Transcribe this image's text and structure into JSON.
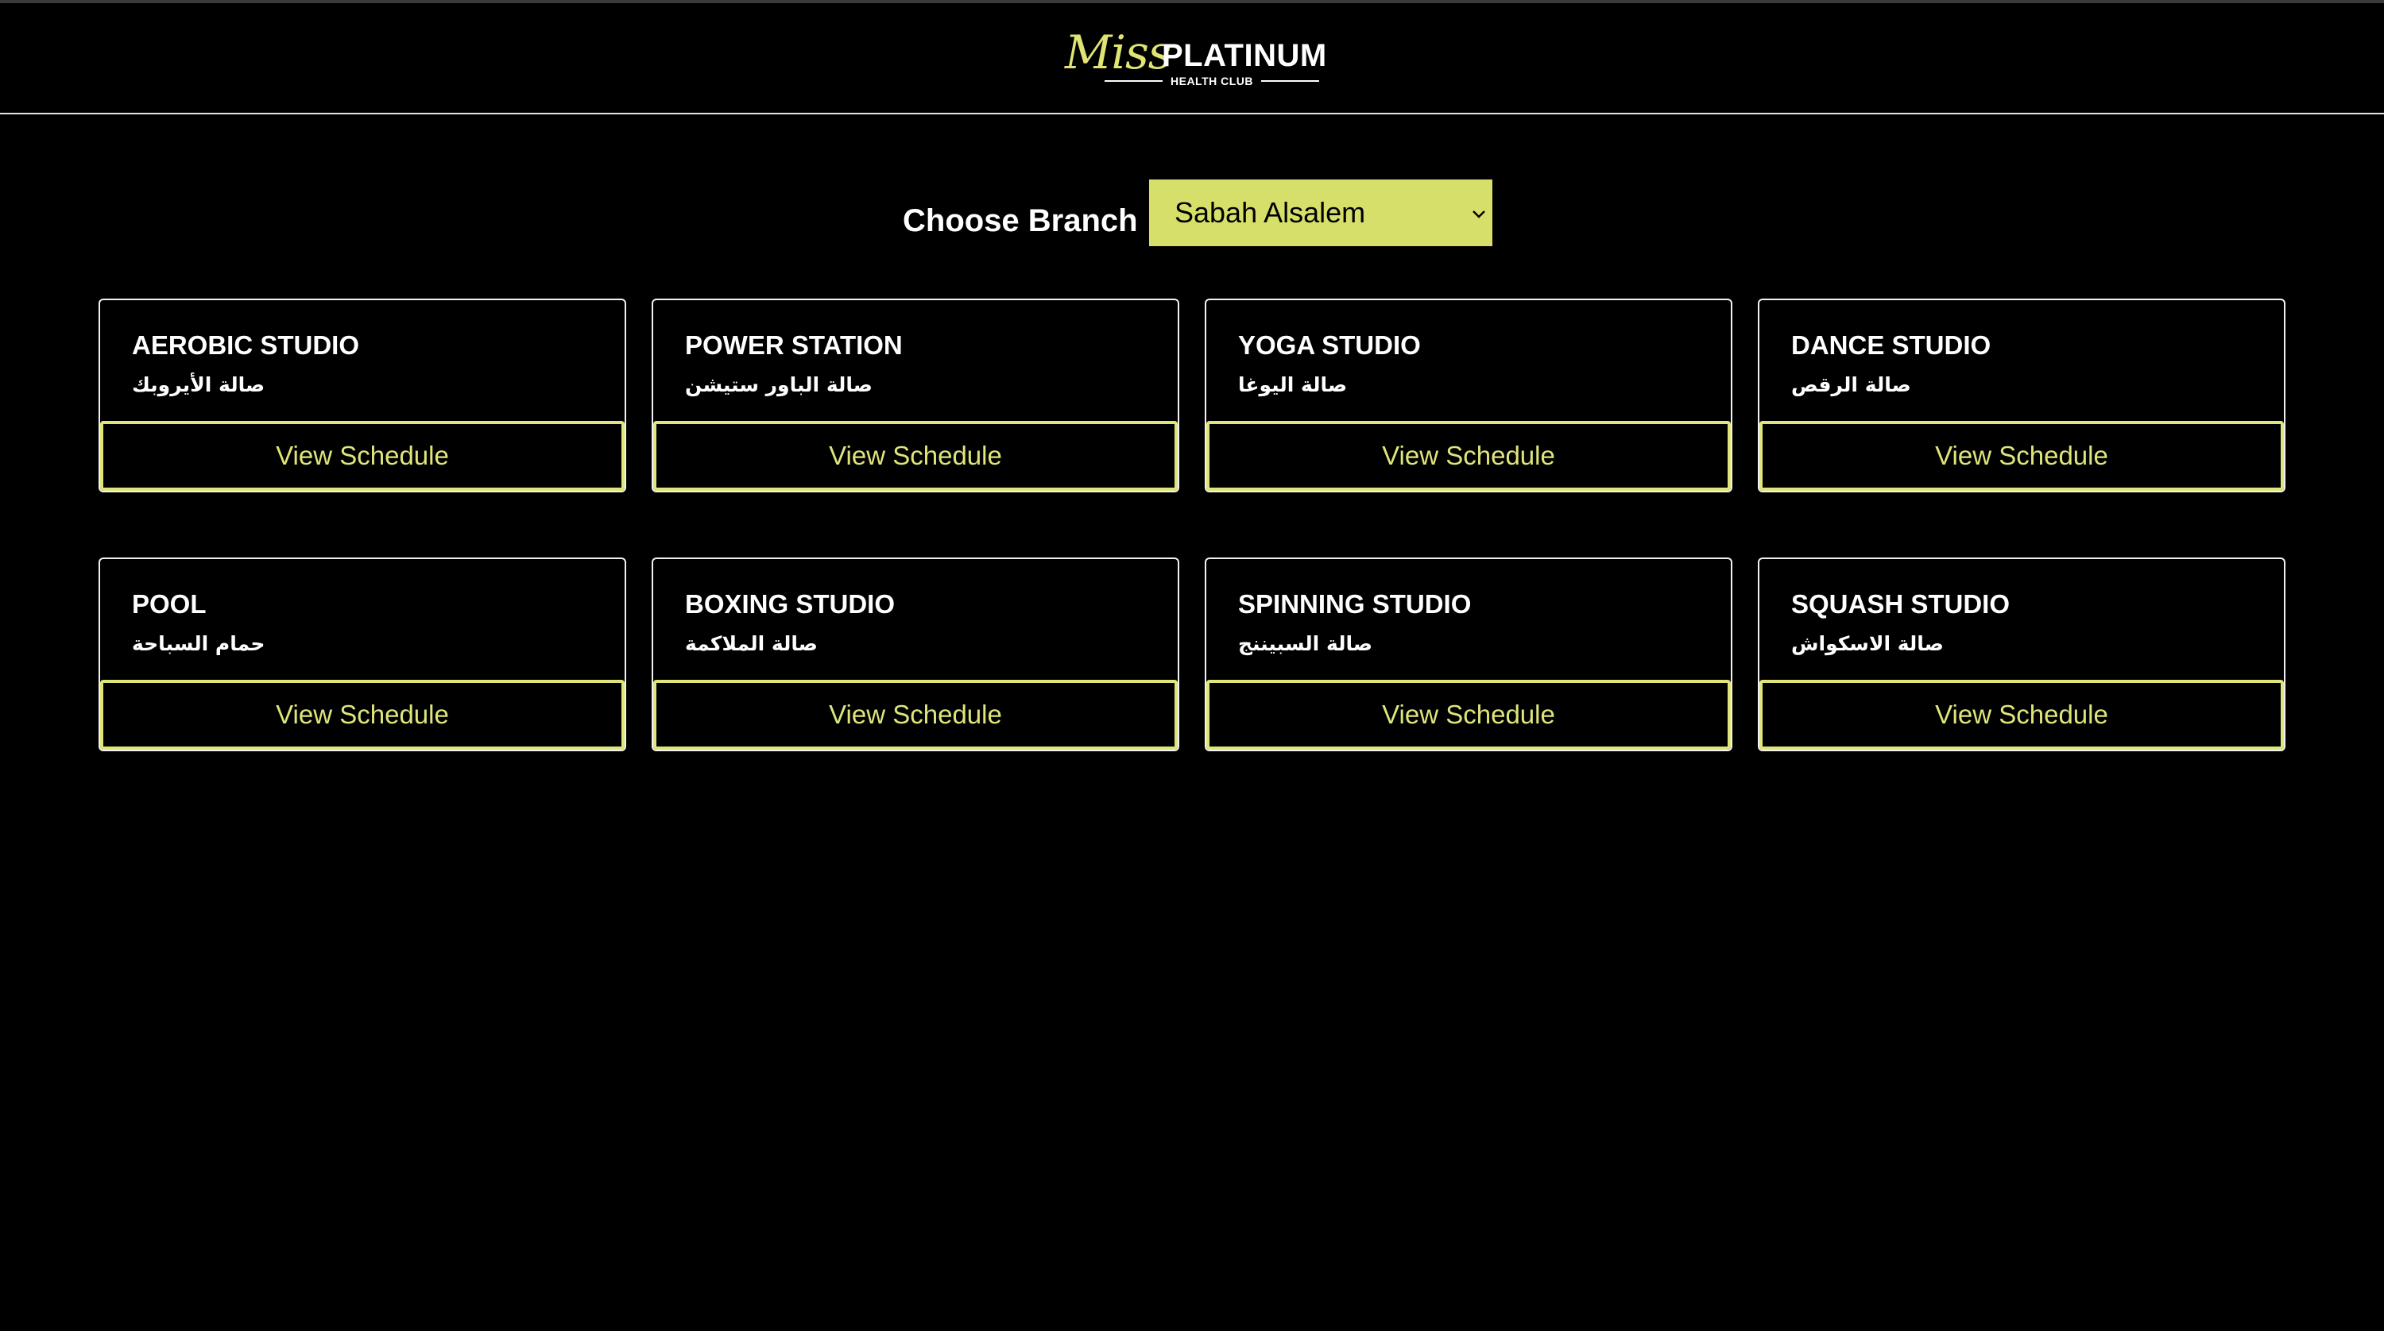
{
  "header": {
    "logo_script": "Miss",
    "logo_brand": "PLATINUM",
    "logo_subtitle": "HEALTH CLUB"
  },
  "branch": {
    "label": "Choose Branch",
    "selected": "Sabah Alsalem"
  },
  "studios": [
    {
      "name": "AEROBIC STUDIO",
      "name_ar": "صالة الأيروبك",
      "button": "View Schedule"
    },
    {
      "name": "POWER STATION",
      "name_ar": "صالة الباور ستيشن",
      "button": "View Schedule"
    },
    {
      "name": "YOGA STUDIO",
      "name_ar": "صالة اليوغا",
      "button": "View Schedule"
    },
    {
      "name": "DANCE STUDIO",
      "name_ar": "صالة الرقص",
      "button": "View Schedule"
    },
    {
      "name": "POOL",
      "name_ar": "حمام السباحة",
      "button": "View Schedule"
    },
    {
      "name": "BOXING STUDIO",
      "name_ar": "صالة الملاكمة",
      "button": "View Schedule"
    },
    {
      "name": "SPINNING STUDIO",
      "name_ar": "صالة السبيننج",
      "button": "View Schedule"
    },
    {
      "name": "SQUASH STUDIO",
      "name_ar": "صالة الاسكواش",
      "button": "View Schedule"
    }
  ],
  "colors": {
    "background": "#000000",
    "accent": "#d7df6b",
    "text": "#ffffff"
  },
  "icons": {
    "select_chevron": "chevron-down-icon"
  }
}
